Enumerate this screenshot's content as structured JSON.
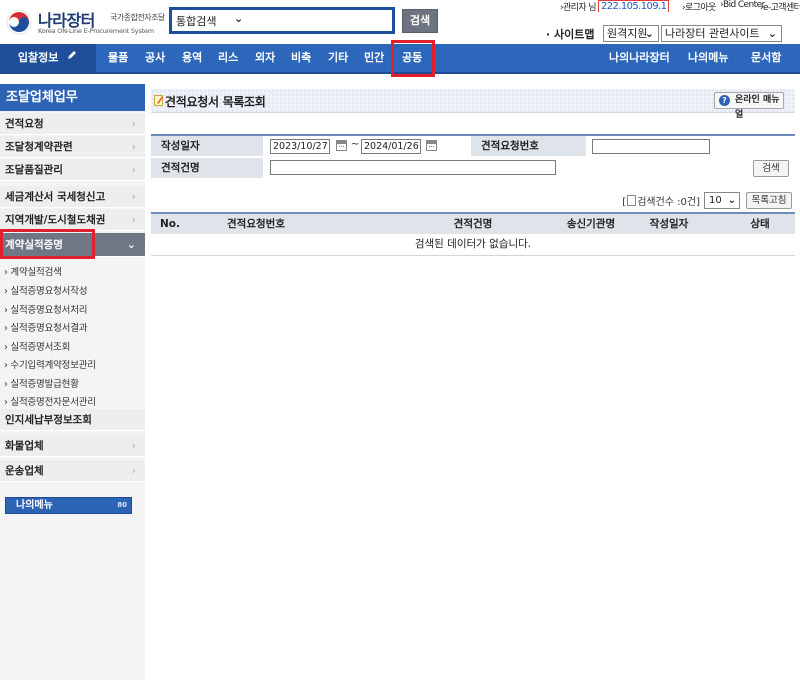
{
  "header": {
    "logo_name": "나라장터",
    "logo_sub_ko": "국가종합전자조달",
    "logo_sub_en": "Korea ON-Line E-Procurement System",
    "search_scope": "통합검색",
    "search_button": "검색",
    "admin_prefix": "›관리자 님",
    "admin_ip": "222.105.109.1",
    "logout": "›로그아웃",
    "bid_center": "›Bid Center",
    "customer_center": "›e-고객센터",
    "sitemap_label": "· 사이트맵",
    "sitemap_select": "원격지원",
    "related_select": "나라장터 관련사이트"
  },
  "nav": {
    "first": "입찰정보",
    "items": [
      "물품",
      "공사",
      "용역",
      "리스",
      "외자",
      "비축",
      "기타",
      "민간",
      "공동"
    ],
    "right": [
      "나의나라장터",
      "나의메뉴",
      "문서함"
    ]
  },
  "sidebar": {
    "title": "조달업체업무",
    "items": [
      "견적요청",
      "조달청계약관련",
      "조달품질관리",
      "세금계산서 국세청신고",
      "지역개발/도시철도채권",
      "계약실적증명"
    ],
    "subitems": [
      "계약실적검색",
      "실적증명요청서작성",
      "실적증명요청서처리",
      "실적증명요청서결과",
      "실적증명서조회",
      "수기입력계약정보관리",
      "실적증명발급현황",
      "실적증명전자문서관리"
    ],
    "items_after": [
      "인지세납부정보조회",
      "화물업체",
      "운송업체"
    ],
    "mymenu": "나의메뉴",
    "mymenu_ok": "80"
  },
  "main": {
    "title": "견적요청서 목록조회",
    "help_button": "온라인 매뉴얼",
    "form": {
      "date_label": "작성일자",
      "date_from": "2023/10/27",
      "date_tilde": "~",
      "date_to": "2024/01/26",
      "req_no_label": "견적요청번호",
      "req_no_value": "",
      "name_label": "견적건명",
      "name_value": "",
      "search_button": "검색"
    },
    "count_open": "[",
    "count_text": "검색건수 :0건]",
    "page_size": "10",
    "refresh_button": "목록고침",
    "columns": [
      "No.",
      "견적요청번호",
      "견적건명",
      "송신기관명",
      "작성일자",
      "상태"
    ],
    "empty_message": "검색된 데이터가 없습니다."
  },
  "colors": {
    "nav_blue": "#2c67bc",
    "highlight_red": "#e2202c",
    "sidebar_active": "#6f7784"
  }
}
